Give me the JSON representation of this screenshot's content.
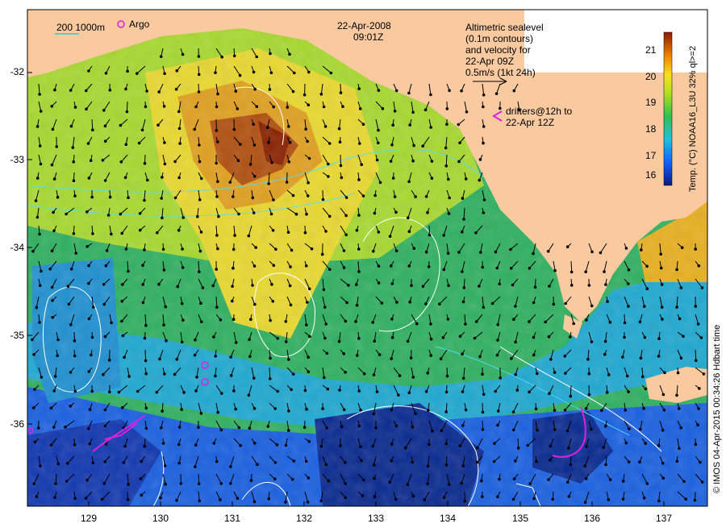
{
  "map": {
    "date": "22-Apr-2008",
    "time": "09:01Z",
    "depth_legend": "200  1000m",
    "argo_label": "Argo",
    "legend_lines": [
      "Altimetric sealevel",
      "(0.1m contours)",
      "and velocity for",
      "22-Apr 09Z",
      "0.5m/s (1kt 24h)"
    ],
    "drifter_label_lines": [
      "drifters@12h to",
      "22-Apr 12Z"
    ],
    "credit": "© IMOS 04-Apr-2015 00:34:26 Hdbart time",
    "colorbar_label": "Temp. (°C) NOAA16_L3U 32% ql>=2",
    "colorbar_ticks": [
      "21",
      "20",
      "19",
      "18",
      "17",
      "16"
    ],
    "y_ticks": [
      "-32",
      "-33",
      "-34",
      "-35",
      "-36"
    ],
    "x_ticks": [
      "129",
      "130",
      "131",
      "132",
      "133",
      "134",
      "135",
      "136",
      "137"
    ],
    "colors": {
      "land": "#f9c9a0",
      "cool": "#0a3cc8",
      "mid": "#3cc060",
      "warm": "#e6a000",
      "hot": "#9a2a0a",
      "drifters": "#e020e0"
    }
  }
}
